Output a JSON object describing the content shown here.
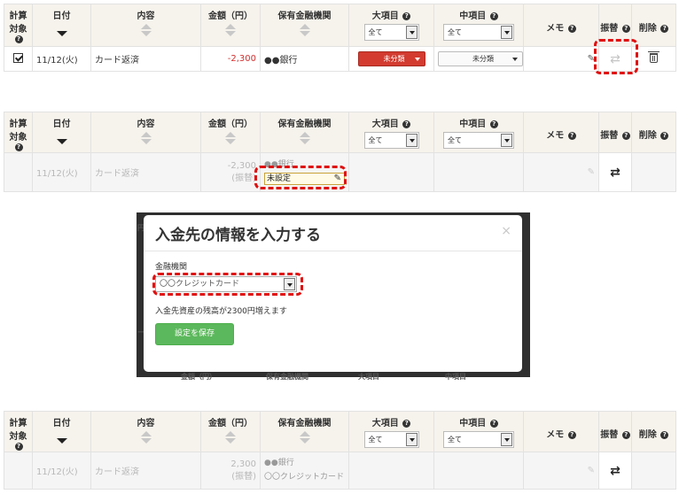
{
  "headers": {
    "calc": [
      "計算",
      "対象"
    ],
    "date": "日付",
    "content": "内容",
    "amount": "金額（円）",
    "bank": "保有金融機関",
    "major": "大項目",
    "middle": "中項目",
    "memo": "メモ",
    "transfer": "振替",
    "delete": "削除",
    "help_glyph": "?",
    "filter_all": "全て"
  },
  "row1": {
    "date": "11/12(火)",
    "content": "カード返済",
    "amount": "-2,300",
    "bank": "●●銀行",
    "major": "未分類",
    "middle": "未分類"
  },
  "row2": {
    "date": "11/12(火)",
    "content": "カード返済",
    "amount": "-2,300",
    "amount_note": "(振替)",
    "bank": "●●銀行",
    "bank_setting": "未設定"
  },
  "row3": {
    "date": "11/12(火)",
    "content": "カード返済",
    "amount": "2,300",
    "amount_note": "(振替)",
    "bank": "●●銀行",
    "bank_dest": "〇〇クレジットカード"
  },
  "modal": {
    "title": "入金先の情報を入力する",
    "close": "×",
    "label": "金融機関",
    "selected": "〇〇クレジットカード",
    "message": "入金先資産の残高が2300円増えます",
    "save": "設定を保存"
  },
  "ghost_headers": [
    "金額（円）",
    "保有金融機関",
    "大項目",
    "中項目"
  ],
  "ghost_side": [
    "円",
    "ー"
  ],
  "colors": {
    "accent_red": "#d33b30",
    "save_green": "#5cb85c",
    "highlight_dash": "#e01010"
  }
}
